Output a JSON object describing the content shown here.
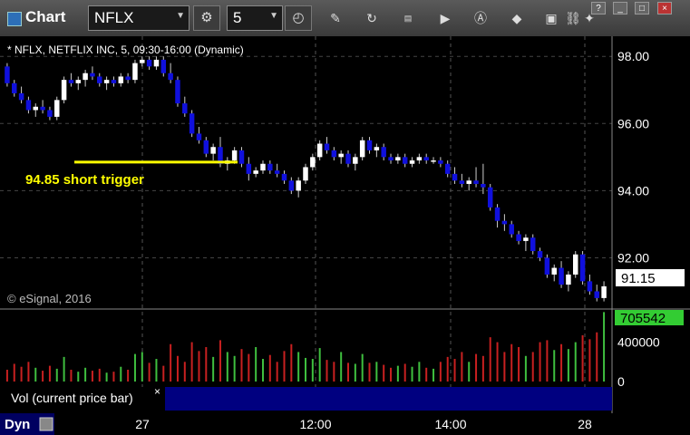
{
  "toolbar": {
    "title": "Chart",
    "symbol": "NFLX",
    "interval": "5",
    "icons": [
      "cycle-icon",
      "clock-icon",
      "pencil-icon",
      "refresh-icon",
      "get-icon",
      "play-icon",
      "a-icon",
      "eraser-icon",
      "fullscreen-icon",
      "link-icon",
      "twitter-icon"
    ],
    "window_buttons": [
      "?",
      "_",
      "□",
      "×"
    ]
  },
  "chart_header": "* NFLX, NETFLIX INC, 5, 09:30-16:00 (Dynamic)",
  "watermark": "© eSignal, 2016",
  "annotation": {
    "text": "94.85 short trigger",
    "price": 94.85
  },
  "last_price_label": "91.15",
  "volume_label": "705542",
  "volume_pane_title": "Vol (current price bar)",
  "volume_close": "×",
  "bottom_left": "Dyn",
  "colors": {
    "up": "#ffffff",
    "down": "#1010dd",
    "annotation": "#ffff00",
    "vol_up": "#3fbf3f",
    "vol_down": "#c82020",
    "volume_badge": "#33cc33"
  },
  "chart_data": {
    "type": "candlestick",
    "y_ticks": [
      "98.00",
      "96.00",
      "94.00",
      "92.00"
    ],
    "x_ticks": [
      "27",
      "12:00",
      "14:00",
      "28"
    ],
    "vol_ticks": [
      "400000",
      "0"
    ],
    "ylim": [
      90.5,
      98.6
    ],
    "vol_max": 700000,
    "series": [
      {
        "name": "price",
        "points": [
          [
            97.7,
            97.8,
            97.1,
            97.2
          ],
          [
            97.2,
            97.3,
            96.8,
            96.9
          ],
          [
            96.9,
            97.1,
            96.6,
            96.7
          ],
          [
            96.7,
            96.8,
            96.3,
            96.4
          ],
          [
            96.4,
            96.6,
            96.2,
            96.5
          ],
          [
            96.5,
            96.7,
            96.3,
            96.4
          ],
          [
            96.4,
            96.5,
            96.1,
            96.2
          ],
          [
            96.2,
            96.8,
            96.1,
            96.7
          ],
          [
            96.7,
            97.4,
            96.6,
            97.3
          ],
          [
            97.3,
            97.5,
            97.1,
            97.2
          ],
          [
            97.2,
            97.4,
            97.0,
            97.3
          ],
          [
            97.3,
            97.6,
            97.1,
            97.5
          ],
          [
            97.5,
            97.7,
            97.3,
            97.4
          ],
          [
            97.4,
            97.5,
            97.1,
            97.2
          ],
          [
            97.2,
            97.4,
            97.0,
            97.3
          ],
          [
            97.3,
            97.4,
            97.1,
            97.2
          ],
          [
            97.2,
            97.5,
            97.1,
            97.4
          ],
          [
            97.4,
            97.5,
            97.2,
            97.3
          ],
          [
            97.3,
            97.9,
            97.2,
            97.8
          ],
          [
            97.8,
            98.0,
            97.7,
            97.9
          ],
          [
            97.9,
            98.0,
            97.6,
            97.7
          ],
          [
            97.7,
            98.0,
            97.6,
            97.9
          ],
          [
            97.9,
            98.0,
            97.4,
            97.5
          ],
          [
            97.5,
            97.8,
            97.2,
            97.3
          ],
          [
            97.3,
            97.4,
            96.5,
            96.6
          ],
          [
            96.6,
            96.8,
            96.2,
            96.3
          ],
          [
            96.3,
            96.4,
            95.6,
            95.7
          ],
          [
            95.7,
            95.9,
            95.4,
            95.5
          ],
          [
            95.5,
            95.6,
            95.0,
            95.1
          ],
          [
            95.1,
            95.4,
            94.9,
            95.3
          ],
          [
            95.3,
            95.6,
            94.7,
            94.8
          ],
          [
            94.8,
            95.0,
            94.6,
            94.9
          ],
          [
            94.9,
            95.3,
            94.8,
            95.2
          ],
          [
            95.2,
            95.3,
            94.7,
            94.8
          ],
          [
            94.8,
            95.0,
            94.3,
            94.5
          ],
          [
            94.5,
            94.7,
            94.4,
            94.6
          ],
          [
            94.6,
            94.9,
            94.5,
            94.8
          ],
          [
            94.8,
            94.9,
            94.5,
            94.6
          ],
          [
            94.6,
            94.8,
            94.4,
            94.5
          ],
          [
            94.5,
            94.6,
            94.2,
            94.3
          ],
          [
            94.3,
            94.4,
            93.9,
            94.0
          ],
          [
            94.0,
            94.4,
            93.8,
            94.3
          ],
          [
            94.3,
            94.8,
            94.2,
            94.7
          ],
          [
            94.7,
            95.1,
            94.6,
            95.0
          ],
          [
            95.0,
            95.5,
            94.9,
            95.4
          ],
          [
            95.4,
            95.6,
            95.1,
            95.2
          ],
          [
            95.2,
            95.3,
            94.9,
            95.0
          ],
          [
            95.0,
            95.2,
            94.8,
            95.1
          ],
          [
            95.1,
            95.2,
            94.7,
            94.8
          ],
          [
            94.8,
            95.1,
            94.6,
            95.0
          ],
          [
            95.0,
            95.6,
            94.9,
            95.5
          ],
          [
            95.5,
            95.6,
            95.1,
            95.2
          ],
          [
            95.2,
            95.4,
            95.0,
            95.3
          ],
          [
            95.3,
            95.4,
            94.9,
            95.0
          ],
          [
            95.0,
            95.1,
            94.8,
            94.9
          ],
          [
            94.9,
            95.1,
            94.8,
            95.0
          ],
          [
            95.0,
            95.1,
            94.7,
            94.8
          ],
          [
            94.8,
            95.0,
            94.7,
            94.9
          ],
          [
            94.9,
            95.1,
            94.8,
            95.0
          ],
          [
            95.0,
            95.1,
            94.8,
            94.9
          ],
          [
            94.9,
            95.0,
            94.8,
            94.9
          ],
          [
            94.9,
            95.0,
            94.7,
            94.8
          ],
          [
            94.8,
            94.9,
            94.4,
            94.5
          ],
          [
            94.5,
            94.7,
            94.2,
            94.3
          ],
          [
            94.3,
            94.5,
            94.1,
            94.2
          ],
          [
            94.2,
            94.4,
            94.0,
            94.3
          ],
          [
            94.3,
            94.7,
            94.1,
            94.2
          ],
          [
            94.2,
            94.8,
            93.9,
            94.1
          ],
          [
            94.1,
            94.2,
            93.4,
            93.5
          ],
          [
            93.5,
            93.6,
            92.9,
            93.1
          ],
          [
            93.1,
            93.3,
            92.8,
            93.0
          ],
          [
            93.0,
            93.1,
            92.6,
            92.7
          ],
          [
            92.7,
            92.8,
            92.4,
            92.5
          ],
          [
            92.5,
            92.7,
            92.2,
            92.6
          ],
          [
            92.6,
            92.7,
            92.1,
            92.2
          ],
          [
            92.2,
            92.3,
            91.9,
            92.0
          ],
          [
            92.0,
            92.1,
            91.4,
            91.5
          ],
          [
            91.5,
            91.8,
            91.3,
            91.7
          ],
          [
            91.7,
            91.9,
            91.1,
            91.2
          ],
          [
            91.2,
            91.6,
            91.0,
            91.5
          ],
          [
            91.5,
            92.2,
            91.4,
            92.1
          ],
          [
            92.1,
            92.2,
            91.2,
            91.3
          ],
          [
            91.3,
            91.5,
            90.9,
            91.0
          ],
          [
            91.0,
            91.2,
            90.7,
            90.8
          ],
          [
            90.8,
            91.3,
            90.7,
            91.15
          ]
        ]
      },
      {
        "name": "volume",
        "values": [
          120000,
          180000,
          150000,
          200000,
          140000,
          110000,
          160000,
          130000,
          250000,
          120000,
          100000,
          140000,
          110000,
          130000,
          90000,
          100000,
          150000,
          120000,
          280000,
          300000,
          190000,
          230000,
          160000,
          380000,
          260000,
          200000,
          400000,
          310000,
          350000,
          250000,
          420000,
          300000,
          260000,
          330000,
          280000,
          350000,
          230000,
          270000,
          200000,
          310000,
          380000,
          300000,
          240000,
          230000,
          340000,
          220000,
          200000,
          300000,
          190000,
          180000,
          280000,
          190000,
          200000,
          170000,
          140000,
          160000,
          180000,
          150000,
          200000,
          140000,
          130000,
          200000,
          250000,
          230000,
          300000,
          200000,
          280000,
          260000,
          450000,
          400000,
          300000,
          380000,
          350000,
          260000,
          300000,
          400000,
          420000,
          320000,
          380000,
          330000,
          400000,
          470000,
          430000,
          500000,
          705542
        ]
      }
    ]
  }
}
